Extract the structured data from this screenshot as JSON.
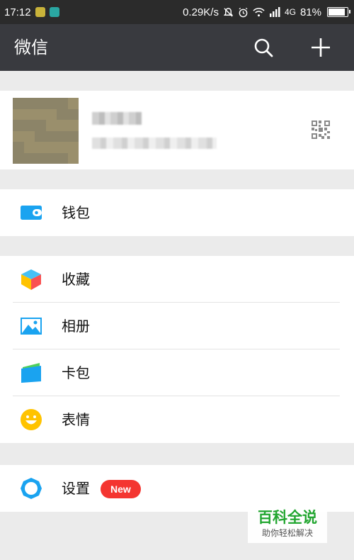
{
  "status_bar": {
    "time": "17:12",
    "speed": "0.29K/s",
    "network": "4G",
    "battery": "81%",
    "battery_level": 0.81
  },
  "header": {
    "title": "微信"
  },
  "profile": {
    "name": "",
    "wechat_id": ""
  },
  "menu": {
    "wallet": "钱包",
    "favorites": "收藏",
    "album": "相册",
    "cards": "卡包",
    "stickers": "表情",
    "settings": "设置",
    "settings_badge": "New"
  },
  "watermark": {
    "main": "百科全说",
    "sub": "助你轻松解决"
  },
  "colors": {
    "title_bar": "#393a3f",
    "status_bar": "#2b2b2b",
    "background": "#ebebeb",
    "accent_blue": "#1aa3f0",
    "badge_red": "#f43530",
    "emoji_yellow": "#ffc300"
  }
}
